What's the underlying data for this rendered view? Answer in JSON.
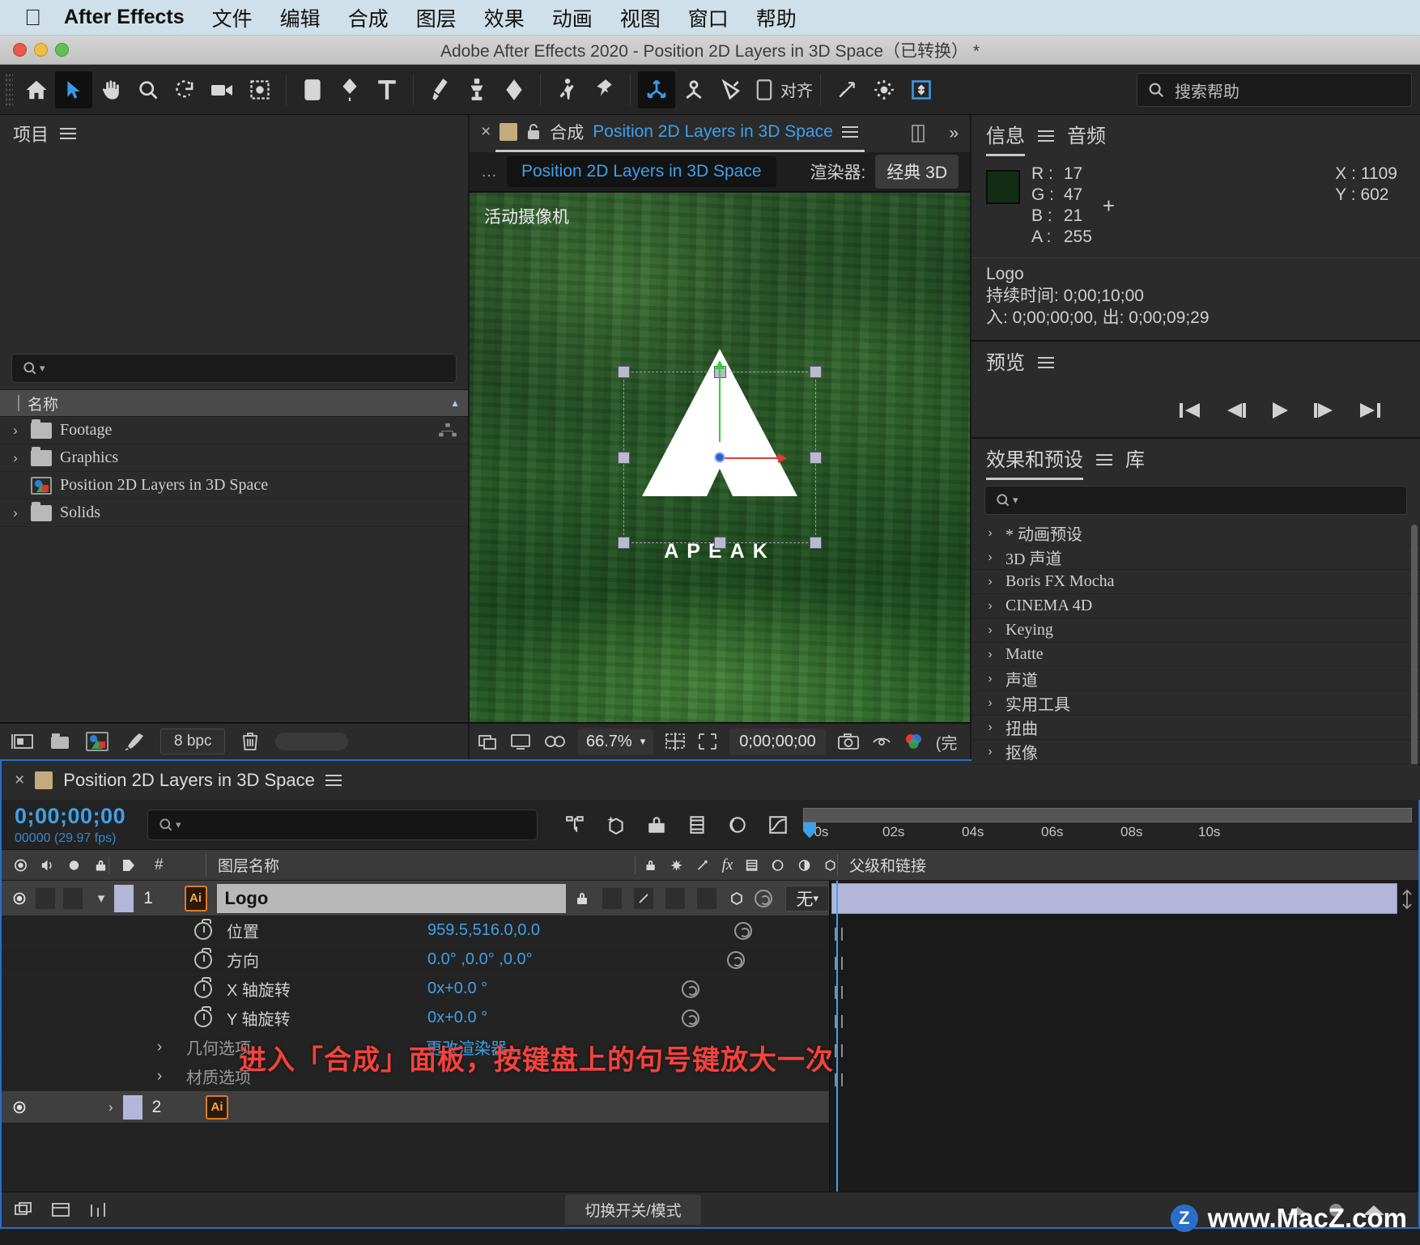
{
  "macmenu": {
    "app_name": "After Effects",
    "items": [
      "文件",
      "编辑",
      "合成",
      "图层",
      "效果",
      "动画",
      "视图",
      "窗口",
      "帮助"
    ]
  },
  "window": {
    "title": "Adobe After Effects 2020 - Position 2D Layers in 3D Space（已转换）  *"
  },
  "toolbar": {
    "snap_label": "对齐",
    "help_placeholder": "搜索帮助",
    "tools": [
      "home-icon",
      "selection-tool",
      "hand-tool",
      "zoom-tool",
      "rotation-tool",
      "camera-tool",
      "pan-behind-tool",
      "shape-tool",
      "pen-tool",
      "type-tool",
      "brush-tool",
      "clone-stamp-tool",
      "eraser-tool",
      "roto-brush-tool",
      "puppet-pin-tool",
      "unified-camera-tool",
      "orbit-tool",
      "track-z-tool"
    ]
  },
  "project": {
    "tab_label": "项目",
    "search_placeholder": "",
    "column_name": "名称",
    "items": [
      {
        "label": "Footage",
        "type": "folder",
        "expandable": true
      },
      {
        "label": "Graphics",
        "type": "folder",
        "expandable": true
      },
      {
        "label": "Position 2D Layers in 3D Space",
        "type": "comp",
        "expandable": false
      },
      {
        "label": "Solids",
        "type": "folder",
        "expandable": true
      }
    ],
    "footer": {
      "bit_depth": "8 bpc"
    }
  },
  "composition": {
    "tab_close": "×",
    "tab_prefix": "合成",
    "tab_name": "Position 2D Layers in 3D Space",
    "chip_name": "Position 2D Layers in 3D Space",
    "renderer_label": "渲染器:",
    "renderer_value": "经典 3D",
    "camera_label": "活动摄像机",
    "logo_text": "APEAK",
    "footer": {
      "zoom": "66.7%",
      "timecode": "0;00;00;00",
      "resolution_abbrev": "(完"
    }
  },
  "info_panel": {
    "tabs": [
      "信息",
      "音频"
    ],
    "selected_tab": "信息",
    "color_hex": "#112e15",
    "channels": [
      {
        "label": "R :",
        "value": "17"
      },
      {
        "label": "G :",
        "value": "47"
      },
      {
        "label": "B :",
        "value": "21"
      },
      {
        "label": "A :",
        "value": "255"
      }
    ],
    "coords": [
      {
        "label": "X :",
        "value": "1109"
      },
      {
        "label": "Y :",
        "value": "602"
      }
    ],
    "layer_name": "Logo",
    "duration_line": "持续时间: 0;00;10;00",
    "inout_line": "入: 0;00;00;00,  出: 0;00;09;29"
  },
  "preview_panel": {
    "title": "预览",
    "buttons": [
      "first-frame",
      "previous-frame",
      "play",
      "next-frame",
      "last-frame"
    ]
  },
  "effects_panel": {
    "tabs": [
      "效果和预设",
      "库"
    ],
    "selected_tab": "效果和预设",
    "search_placeholder": "",
    "categories": [
      "* 动画预设",
      "3D 声道",
      "Boris FX Mocha",
      "CINEMA 4D",
      "Keying",
      "Matte",
      "声道",
      "实用工具",
      "扭曲",
      "抠像"
    ]
  },
  "timeline": {
    "tab_name": "Position 2D Layers in 3D Space",
    "current_time": "0;00;00;00",
    "frame_info": "00000 (29.97 fps)",
    "search_placeholder": "",
    "columns": {
      "layer_name": "图层名称",
      "parent": "父级和链接",
      "number": "#"
    },
    "ruler_ticks": [
      "00s",
      "02s",
      "04s",
      "06s",
      "08s",
      "10s"
    ],
    "layers": [
      {
        "index": "1",
        "name": "Logo",
        "source_type": "Ai",
        "parent": "无",
        "properties": [
          {
            "label": "位置",
            "value": "959.5,516.0,0.0"
          },
          {
            "label": "方向",
            "value": "0.0° ,0.0° ,0.0°"
          },
          {
            "label": "X 轴旋转",
            "value": "0x+0.0 °"
          },
          {
            "label": "Y 轴旋转",
            "value": "0x+0.0 °"
          },
          {
            "label": "几何选项",
            "value": "更改渲染器...",
            "group": true
          },
          {
            "label": "材质选项",
            "value": "",
            "group": true
          }
        ]
      },
      {
        "index": "2",
        "name": "",
        "source_type": "Ai",
        "parent": "",
        "properties": []
      }
    ],
    "footer": {
      "switches_modes": "切换开关/模式"
    }
  },
  "annotation": {
    "text": "进入「合成」面板，按键盘上的句号键放大一次",
    "color": "#f4423c"
  },
  "watermark": {
    "badge": "Z",
    "text": "www.MacZ.com"
  }
}
